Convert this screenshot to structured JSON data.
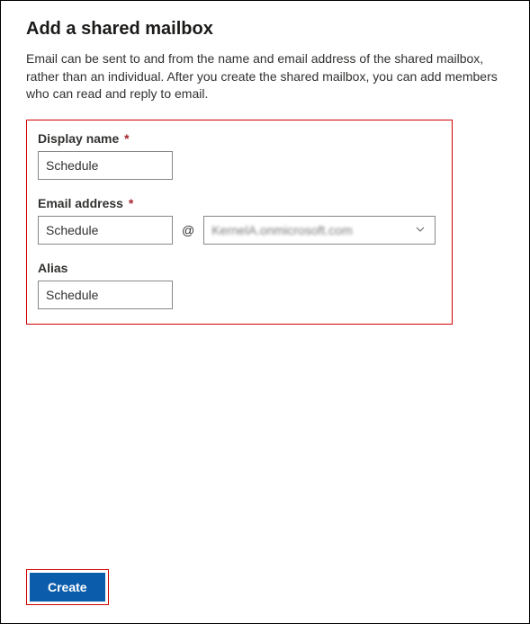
{
  "header": {
    "title": "Add a shared mailbox",
    "description": "Email can be sent to and from the name and email address of the shared mailbox, rather than an individual. After you create the shared mailbox, you can add members who can read and reply to email."
  },
  "form": {
    "displayName": {
      "label": "Display name",
      "required": "*",
      "value": "Schedule"
    },
    "emailAddress": {
      "label": "Email address",
      "required": "*",
      "value": "Schedule",
      "at": "@",
      "domain": "KernelA.onmicrosoft.com"
    },
    "alias": {
      "label": "Alias",
      "value": "Schedule"
    }
  },
  "footer": {
    "createLabel": "Create"
  }
}
